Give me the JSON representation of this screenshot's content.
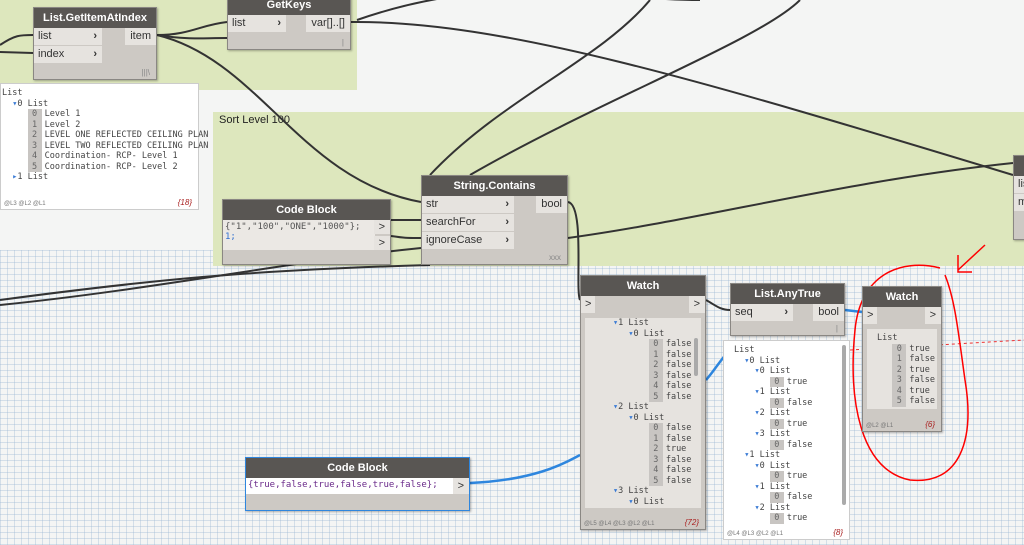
{
  "groups": {
    "sort_title": "Sort Level 100"
  },
  "get_item": {
    "title": "List.GetItemAtIndex",
    "in1": "list",
    "in2": "index",
    "out": "item",
    "lacing": "|||\\"
  },
  "get_keys": {
    "title": "GetKeys",
    "in1": "list",
    "out": "var[]..[]",
    "lacing": "|"
  },
  "preview_left": {
    "root": "List",
    "sub0": "0 List",
    "items": [
      "Level 1",
      "Level 2",
      "LEVEL ONE REFLECTED CEILING PLAN",
      "LEVEL TWO REFLECTED CEILING PLAN",
      "Coordination- RCP- Level 1",
      "Coordination- RCP- Level 2"
    ],
    "sub1": "1 List",
    "levels": "@L3 @L2 @L1",
    "count": "{18}"
  },
  "code_block1": {
    "title": "Code Block",
    "line1": "{\"1\",\"100\",\"ONE\",\"1000\"};",
    "line2": "1;",
    "out": ">"
  },
  "string_contains": {
    "title": "String.Contains",
    "in1": "str",
    "in2": "searchFor",
    "in3": "ignoreCase",
    "out": "bool",
    "lacing": "xxx"
  },
  "watch_mid": {
    "title": "Watch",
    "in": ">",
    "out": ">",
    "groups": [
      {
        "label": "1 List",
        "sub": "0 List",
        "values": [
          "false",
          "false",
          "false",
          "false",
          "false",
          "false"
        ]
      },
      {
        "label": "2 List",
        "sub": "0 List",
        "values": [
          "false",
          "false",
          "true",
          "false",
          "false",
          "false"
        ]
      },
      {
        "label": "3 List",
        "sub": "0 List"
      }
    ],
    "levels": "@L5 @L4 @L3 @L2 @L1",
    "count": "{72}"
  },
  "any_true": {
    "title": "List.AnyTrue",
    "in1": "seq",
    "out": "bool",
    "lacing": "|"
  },
  "preview_any": {
    "root": "List",
    "g0": "0 List",
    "g1": "1 List",
    "rows0": [
      [
        "0 List",
        "true"
      ],
      [
        "1 List",
        "false"
      ],
      [
        "2 List",
        "true"
      ],
      [
        "3 List",
        "false"
      ]
    ],
    "rows1": [
      [
        "0 List",
        "true"
      ],
      [
        "1 List",
        "false"
      ],
      [
        "2 List",
        "true"
      ]
    ],
    "levels": "@L4 @L3 @L2 @L1",
    "count": "{8}"
  },
  "watch_right": {
    "title": "Watch",
    "in": ">",
    "out": ">",
    "root": "List",
    "values": [
      "true",
      "false",
      "true",
      "false",
      "true",
      "false"
    ],
    "levels": "@L2 @L1",
    "count": "{6}"
  },
  "code_block2": {
    "title": "Code Block",
    "line1": "{true,false,true,false,true,false};",
    "out": ">"
  },
  "edge_node": {
    "in1": "lis",
    "in2": "m"
  },
  "colors": {
    "group": "#dde7bd",
    "node_header": "#595653",
    "annotation": "#ff0000",
    "wire_blue": "#2e86de"
  }
}
